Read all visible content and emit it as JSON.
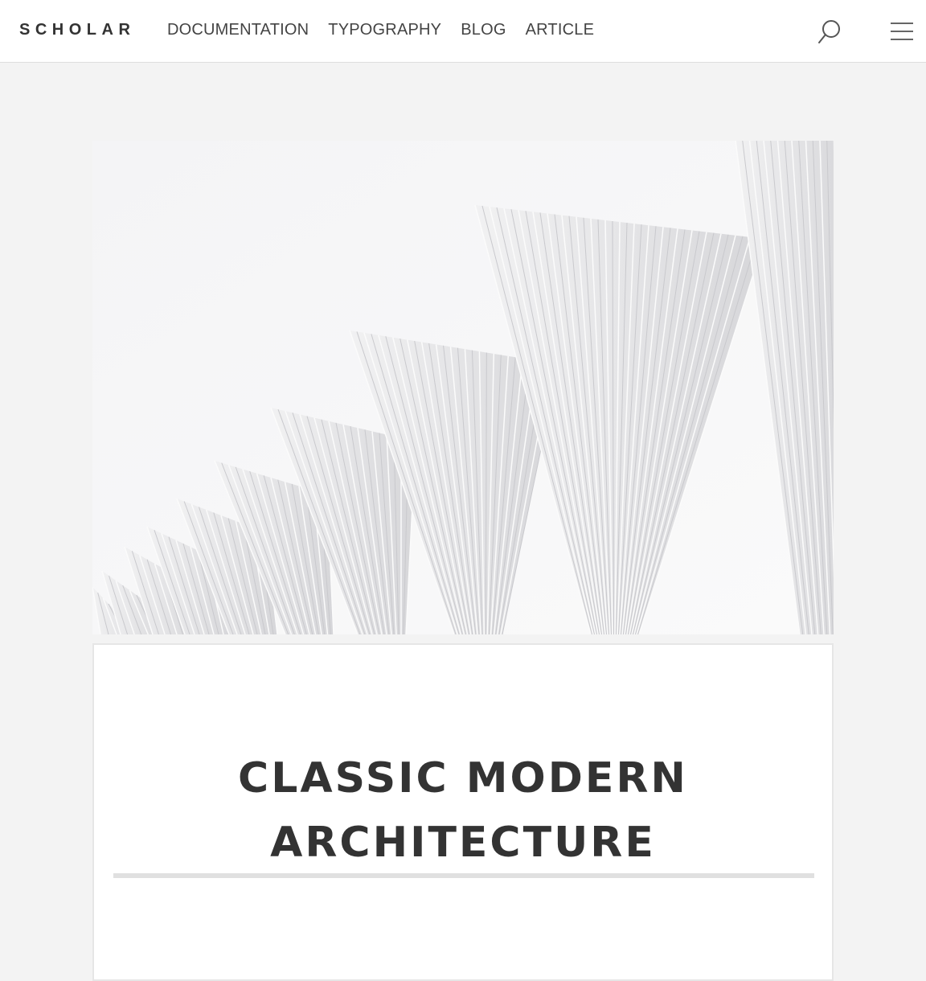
{
  "brand": {
    "name": "SCHOLAR"
  },
  "nav": {
    "items": [
      {
        "label": "DOCUMENTATION"
      },
      {
        "label": "TYPOGRAPHY"
      },
      {
        "label": "BLOG"
      },
      {
        "label": "ARTICLE"
      }
    ]
  },
  "header": {
    "search_icon": "search-icon",
    "menu_icon": "hamburger-menu-icon"
  },
  "hero": {
    "alt": "White modern architecture with fan-like pleated structures"
  },
  "article": {
    "title_line1": "CLASSIC MODERN",
    "title_line2": "ARCHITECTURE"
  },
  "colors": {
    "page_bg": "#f3f3f3",
    "header_bg": "#ffffff",
    "text": "#333333",
    "rule": "#e0e0e0"
  }
}
